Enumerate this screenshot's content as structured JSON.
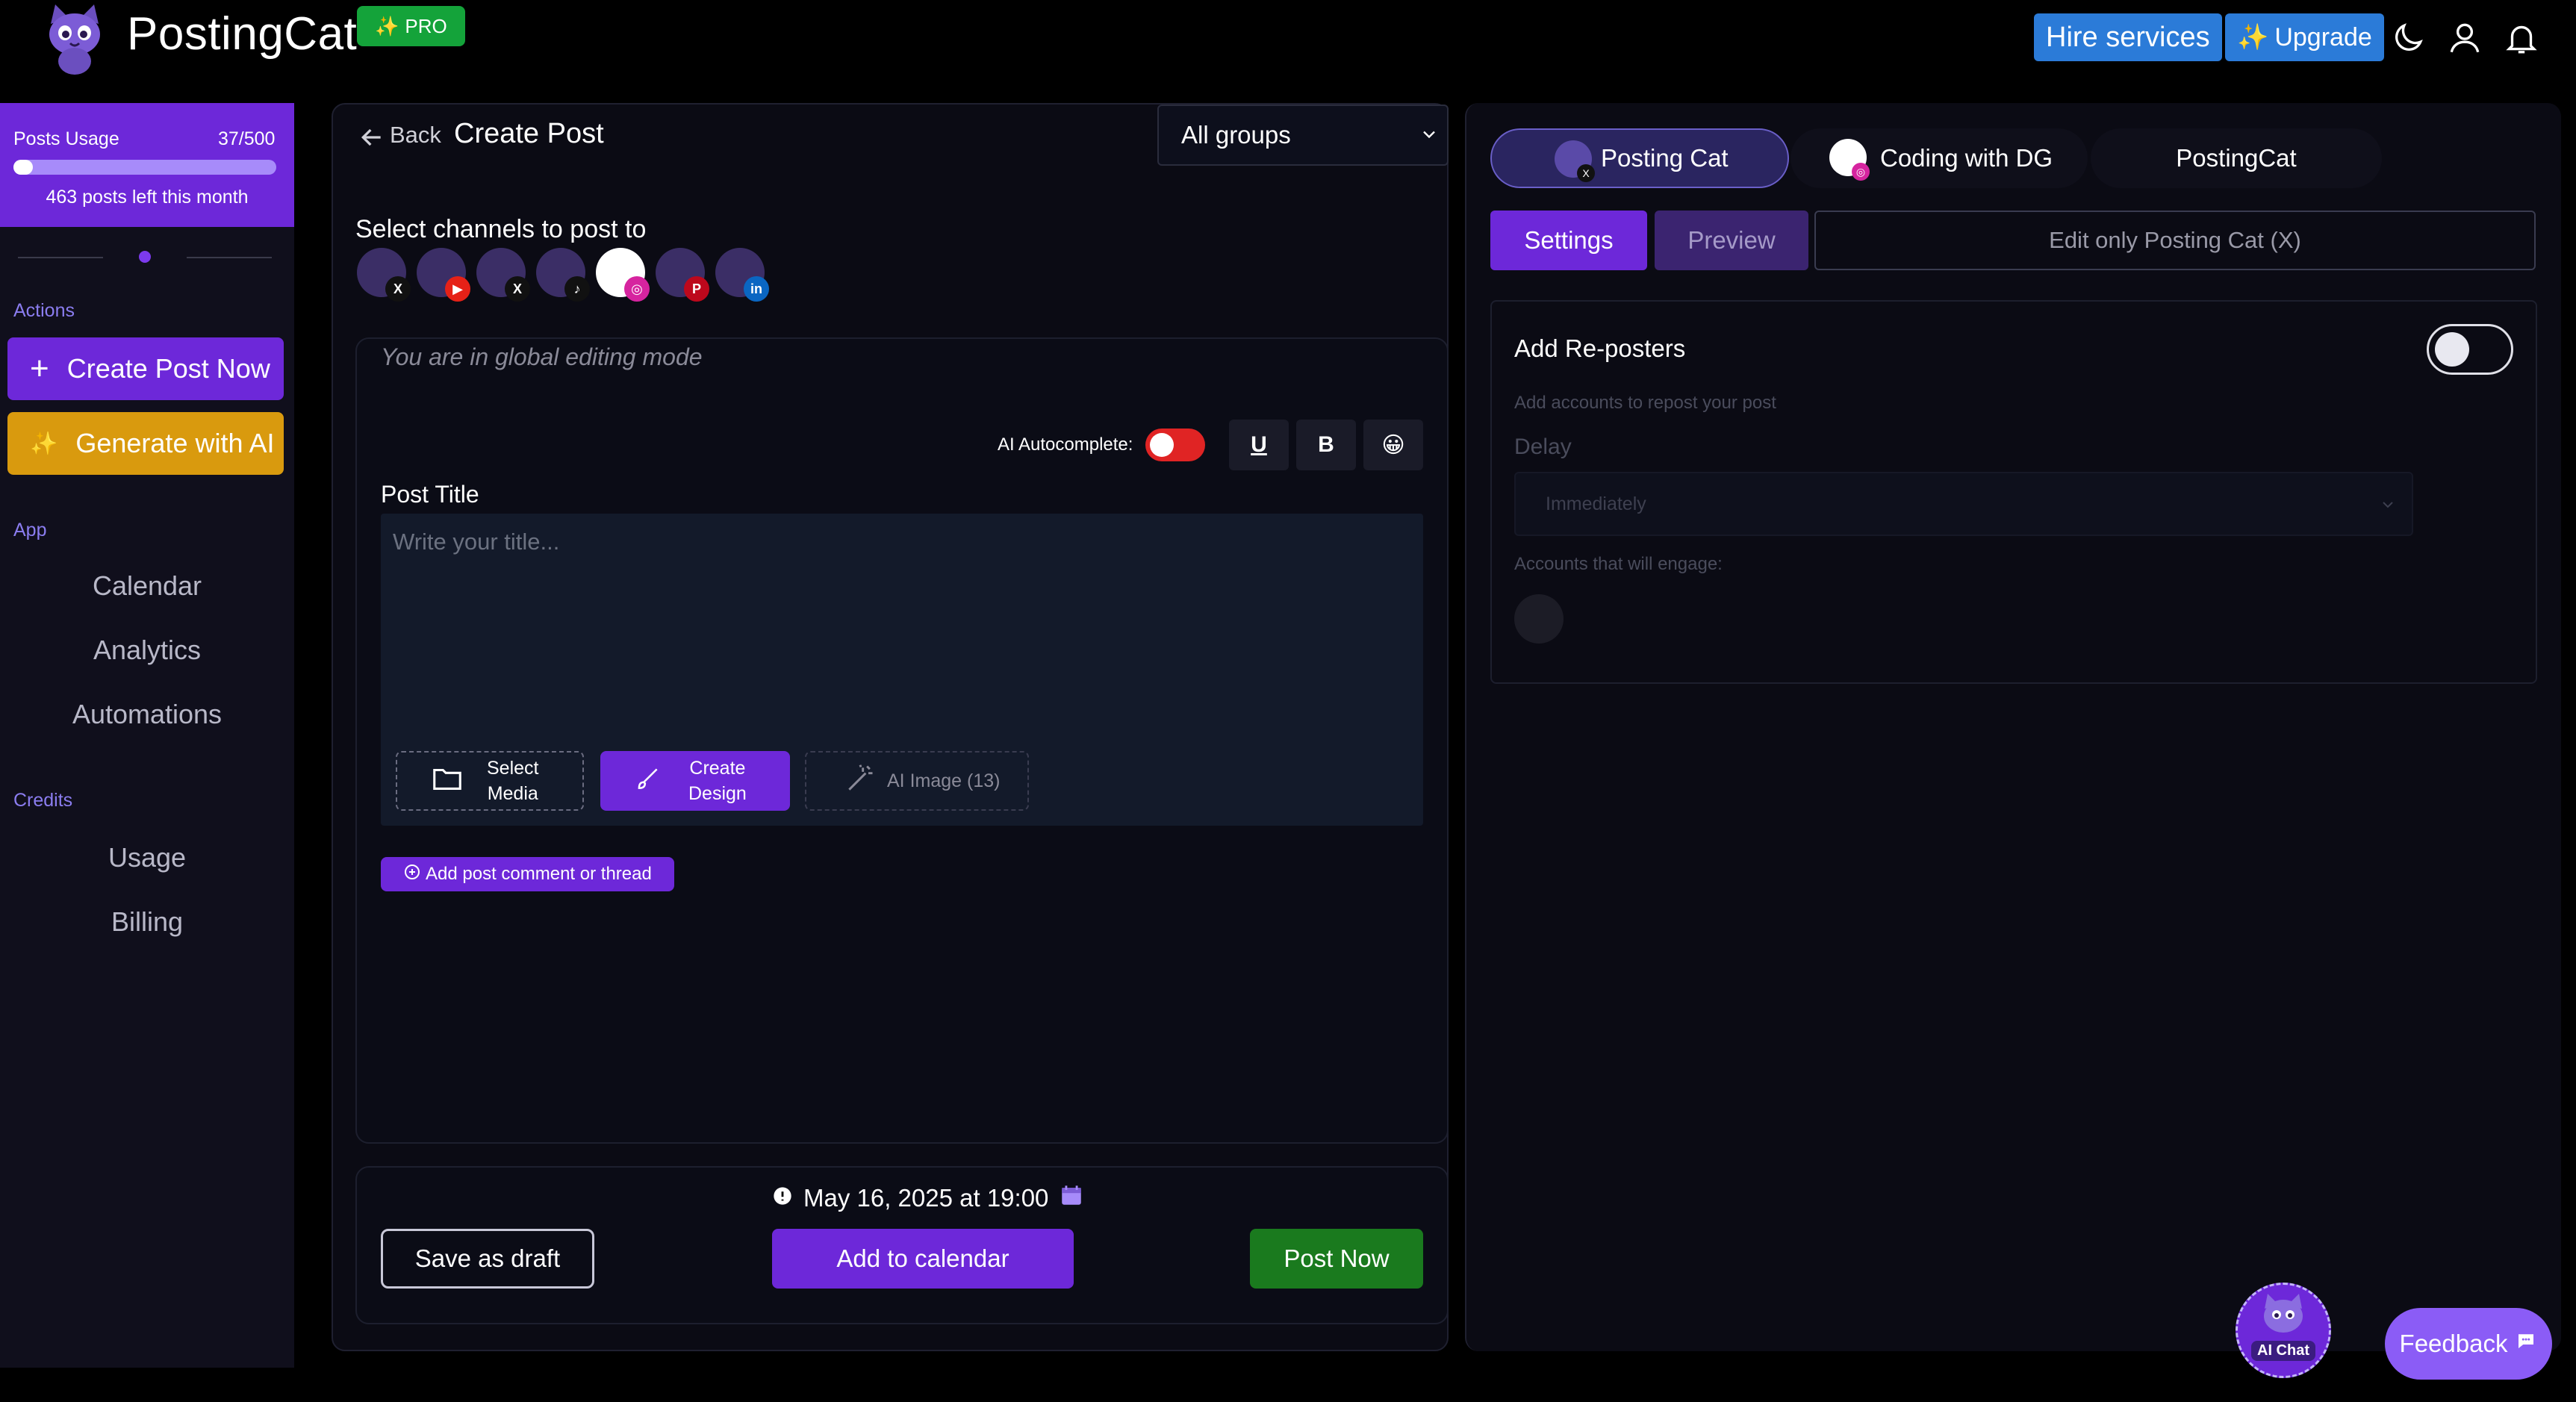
{
  "header": {
    "brand": "PostingCat",
    "pro_badge": "PRO",
    "hire_label": "Hire services",
    "upgrade_label": "Upgrade"
  },
  "sidebar": {
    "usage": {
      "label": "Posts Usage",
      "count": "37/500",
      "used": 37,
      "total": 500,
      "remaining_text": "463 posts left this month"
    },
    "actions_label": "Actions",
    "create_post_label": "Create Post Now",
    "generate_ai_label": "Generate with AI",
    "app_label": "App",
    "app_items": [
      {
        "label": "Calendar"
      },
      {
        "label": "Analytics"
      },
      {
        "label": "Automations"
      }
    ],
    "credits_label": "Credits",
    "credit_items": [
      {
        "label": "Usage"
      },
      {
        "label": "Billing"
      }
    ]
  },
  "composer": {
    "back_label": "Back",
    "title": "Create Post",
    "groups_value": "All groups",
    "channels_label": "Select channels to post to",
    "channels": [
      {
        "platform": "x-icon",
        "badge": "X",
        "color": "#111111"
      },
      {
        "platform": "youtube-icon",
        "badge": "▶",
        "color": "#e62117"
      },
      {
        "platform": "x-icon",
        "badge": "X",
        "color": "#111111"
      },
      {
        "platform": "tiktok-icon",
        "badge": "♪",
        "color": "#111111"
      },
      {
        "platform": "instagram-icon",
        "badge": "◎",
        "color": "#d6249f"
      },
      {
        "platform": "pinterest-icon",
        "badge": "P",
        "color": "#bd081c"
      },
      {
        "platform": "linkedin-icon",
        "badge": "in",
        "color": "#0a66c2"
      }
    ],
    "global_mode_text": "You are in global editing mode",
    "ai_autocomplete_label": "AI Autocomplete:",
    "underline_label": "U",
    "bold_label": "B",
    "emoji_label": "😀",
    "post_title_label": "Post Title",
    "title_placeholder": "Write your title...",
    "select_media_line1": "Select",
    "select_media_line2": "Media",
    "create_design_line1": "Create",
    "create_design_line2": "Design",
    "ai_image_label": "AI Image (13)",
    "add_comment_label": "Add post comment or thread",
    "date_text": "May 16, 2025 at 19:00",
    "save_draft_label": "Save as draft",
    "add_calendar_label": "Add to calendar",
    "post_now_label": "Post Now"
  },
  "right_panel": {
    "accounts": [
      {
        "name": "Posting Cat"
      },
      {
        "name": "Coding with DG"
      },
      {
        "name": "PostingCat"
      }
    ],
    "settings_tab": "Settings",
    "preview_tab": "Preview",
    "edit_only_label": "Edit only Posting Cat (X)",
    "reposters_title": "Add Re-posters",
    "reposters_desc": "Add accounts to repost your post",
    "delay_label": "Delay",
    "delay_value": "Immediately",
    "engage_label": "Accounts that will engage:"
  },
  "floating": {
    "aichat_label": "AI Chat",
    "feedback_label": "Feedback"
  },
  "colors": {
    "accent": "#6d28d9",
    "pro_green": "#14a33a",
    "hire_blue": "#2b7bd8",
    "ai_gold": "#d99a0e",
    "post_now_green": "#1a7a1e"
  }
}
